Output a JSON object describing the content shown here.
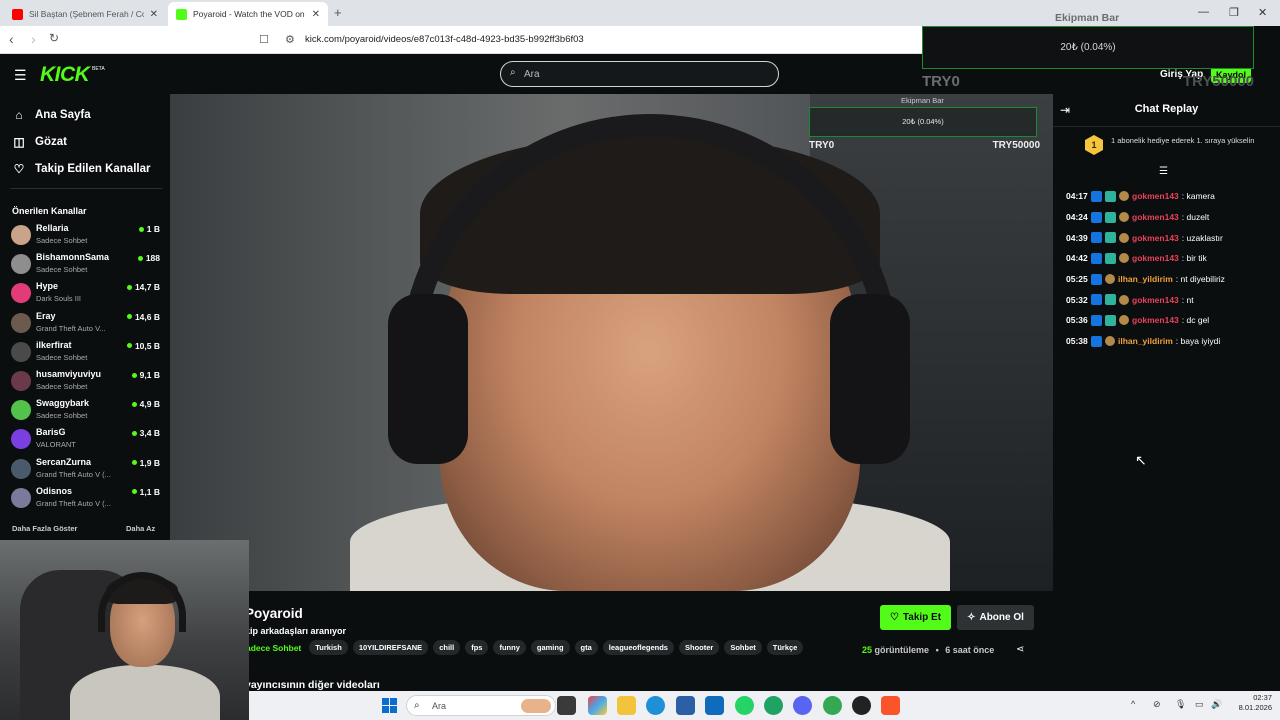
{
  "browser": {
    "tabs": [
      {
        "title": "Sil Baştan (Şebnem Ferah / Cover) - ",
        "favicon_color": "#ff0000"
      },
      {
        "title": "Poyaroid - Watch the VOD on",
        "favicon_color": "#53fc18"
      }
    ],
    "new_tab": "+",
    "url": "kick.com/poyaroid/videos/e87c013f-c48d-4923-bd35-b992ff3b6f03"
  },
  "header": {
    "logo": "KICK",
    "logo_badge": "BETA",
    "search_placeholder": "Ara",
    "login": "Giriş Yap",
    "register": "Kaydol"
  },
  "sidebar": {
    "nav": [
      {
        "label": "Ana Sayfa",
        "icon": "home-icon"
      },
      {
        "label": "Gözat",
        "icon": "browse-icon"
      },
      {
        "label": "Takip Edilen Kanallar",
        "icon": "heart-icon"
      }
    ],
    "recommended_title": "Önerilen Kanallar",
    "channels": [
      {
        "name": "Rellaria",
        "category": "Sadece Sohbet",
        "viewers": "1 B",
        "color": "#c9a38a"
      },
      {
        "name": "BishamonnSama",
        "category": "Sadece Sohbet",
        "viewers": "188",
        "color": "#8e8e8e"
      },
      {
        "name": "Hype",
        "category": "Dark Souls III",
        "viewers": "14,7 B",
        "color": "#e23b7a"
      },
      {
        "name": "Eray",
        "category": "Grand Theft Auto V...",
        "viewers": "14,6 B",
        "color": "#6d5a4e"
      },
      {
        "name": "ilkerfirat",
        "category": "Sadece Sohbet",
        "viewers": "10,5 B",
        "color": "#4a4a4a"
      },
      {
        "name": "husamviyuviyu",
        "category": "Sadece Sohbet",
        "viewers": "9,1 B",
        "color": "#6b3a4a"
      },
      {
        "name": "Swaggybark",
        "category": "Sadece Sohbet",
        "viewers": "4,9 B",
        "color": "#53c24b"
      },
      {
        "name": "BarisG",
        "category": "VALORANT",
        "viewers": "3,4 B",
        "color": "#7a3fe0"
      },
      {
        "name": "SercanZurna",
        "category": "Grand Theft Auto V (...",
        "viewers": "1,9 B",
        "color": "#4a5a6a"
      },
      {
        "name": "Odisnos",
        "category": "Grand Theft Auto V (...",
        "viewers": "1,1 B",
        "color": "#7a7a9a"
      }
    ],
    "show_more": "Daha Fazla Göster",
    "show_less": "Daha Az"
  },
  "overlay_small": {
    "label": "Ekipman Bar",
    "progress": "20₺ (0.04%)",
    "min": "TRY0",
    "max": "TRY50000"
  },
  "overlay_large": {
    "label": "Ekipman Bar",
    "progress": "20₺ (0.04%)",
    "min": "TRY0",
    "max": "TRY50000"
  },
  "chat": {
    "title": "Chat Replay",
    "pinned_rank": "1",
    "pinned_text": "1 abonelik hediye ederek 1. sıraya yükselin",
    "messages": [
      {
        "time": "04:17",
        "user": "gokmen143",
        "text": ": kamera",
        "color": "#e9415b",
        "badges": 3
      },
      {
        "time": "04:24",
        "user": "gokmen143",
        "text": ": duzelt",
        "color": "#e9415b",
        "badges": 3
      },
      {
        "time": "04:39",
        "user": "gokmen143",
        "text": ": uzaklastır",
        "color": "#e9415b",
        "badges": 3
      },
      {
        "time": "04:42",
        "user": "gokmen143",
        "text": ": bir tik",
        "color": "#e9415b",
        "badges": 3
      },
      {
        "time": "05:25",
        "user": "ilhan_yildirim",
        "text": ": nt diyebiliriz",
        "color": "#f2a03a",
        "badges": 2
      },
      {
        "time": "05:32",
        "user": "gokmen143",
        "text": ": nt",
        "color": "#e9415b",
        "badges": 3
      },
      {
        "time": "05:36",
        "user": "gokmen143",
        "text": ": dc gel",
        "color": "#e9415b",
        "badges": 3
      },
      {
        "time": "05:38",
        "user": "ilhan_yildirim",
        "text": ": baya iyiydi",
        "color": "#f2a03a",
        "badges": 2
      }
    ]
  },
  "video_info": {
    "streamer": "Poyaroid",
    "title": "kip arkadaşları aranıyor",
    "category": "adece Sohbet",
    "tags": [
      "Turkish",
      "10YILDIREFSANE",
      "chill",
      "fps",
      "funny",
      "gaming",
      "gta",
      "leagueoflegends",
      "Shooter",
      "Sohbet",
      "Türkçe"
    ],
    "follow": "Takip Et",
    "subscribe": "Abone Ol",
    "views_count": "25",
    "views_label": "görüntüleme",
    "age": "6 saat önce",
    "other_videos": "yayıncısının diğer videoları"
  },
  "taskbar": {
    "search_placeholder": "Ara",
    "time": "02:37",
    "date": "8.01.2026"
  }
}
